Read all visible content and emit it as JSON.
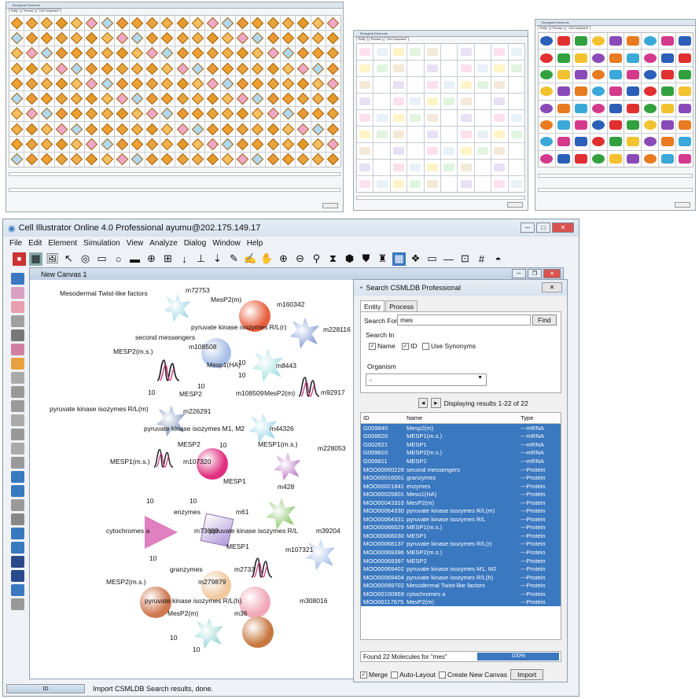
{
  "palette_windows": [
    {
      "title": "Biological Elements",
      "tabs": [
        "Entity",
        "Process",
        "Cell Component"
      ]
    },
    {
      "title": "Biological Elements",
      "tabs": [
        "Entity",
        "Process",
        "Cell Component"
      ]
    },
    {
      "title": "Biological Elements",
      "tabs": [
        "Entity",
        "Process",
        "Cell Component"
      ]
    }
  ],
  "app": {
    "title": "Cell Illustrator Online 4.0 Professional ayumu@202.175.149.17",
    "menu": [
      "File",
      "Edit",
      "Element",
      "Simulation",
      "View",
      "Analyze",
      "Dialog",
      "Window",
      "Help"
    ]
  },
  "canvas": {
    "title": "New Canvas 1",
    "labels": [
      "Mesodermal Twist-like factors",
      "m72753",
      "MesP2(m)",
      "m160342",
      "pyruvate kinase isozymes R/L(r)",
      "m228116",
      "second messengers",
      "m108508",
      "MESP2(m.s.)",
      "Mesp1(HA)",
      "m8443",
      "10",
      "10",
      "10",
      "10",
      "MESP2",
      "m108509",
      "MesP2(m)",
      "m92917",
      "pyruvate kinase isozymes R/L(m)",
      "m226291",
      "pyruvate kinase isozymes M1, M2",
      "m44326",
      "10",
      "MESP2",
      "MESP1(m.s.)",
      "m228053",
      "MESP1(m.s.)",
      "m107320",
      "MESP1",
      "m428",
      "10",
      "10",
      "enzymes",
      "m61",
      "cytochromes a",
      "m73600",
      "pyruvate kinase isozymes R/L",
      "m39204",
      "MESP1",
      "m107321",
      "10",
      "granzymes",
      "m2733",
      "MESP2(m.s.)",
      "m279879",
      "pyruvate kinase isozymes R/L(h)",
      "m308016",
      "MesP2(m)",
      "m36",
      "10",
      "10"
    ]
  },
  "status": {
    "box": "ID",
    "text": "Import CSMLDB Search results, done."
  },
  "search": {
    "title": "Search CSMLDB Professional",
    "tabs": [
      "Entity",
      "Process"
    ],
    "search_for_label": "Search For",
    "search_for_value": "mes",
    "find_label": "Find",
    "search_in_label": "Search In",
    "options": [
      "Name",
      "ID",
      "Use Synonyms"
    ],
    "organism_label": "Organism",
    "organism_value": "-",
    "displaying": "Displaying results 1-22 of 22",
    "columns": [
      "ID",
      "Name",
      "Type"
    ],
    "rows": [
      [
        "G009840",
        "Mesp2(m)",
        "---mRNA"
      ],
      [
        "G008620",
        "MESP1(m.s.)",
        "---mRNA"
      ],
      [
        "G002621",
        "MESP1",
        "---mRNA"
      ],
      [
        "G009810",
        "MESP2(m.s.)",
        "---mRNA"
      ],
      [
        "G009811",
        "MESP2",
        "---mRNA"
      ],
      [
        "MOO00000226",
        "second messengers",
        "---Protein"
      ],
      [
        "MOO00016001",
        "granzymes",
        "---Protein"
      ],
      [
        "MOO00021841",
        "enzymes",
        "---Protein"
      ],
      [
        "MOO00025801",
        "Meso1(HA)",
        "---Protein"
      ],
      [
        "MOO00043316",
        "MesP2(m)",
        "---Protein"
      ],
      [
        "MOO00064330",
        "pyruvate kinase isozymes R/L(m)",
        "---Protein"
      ],
      [
        "MOO00064331",
        "pyruvate kinase isozymes R/L",
        "---Protein"
      ],
      [
        "MOO00066029",
        "MESP1(m.s.)",
        "---Protein"
      ],
      [
        "MOO00066030",
        "MESP1",
        "---Protein"
      ],
      [
        "MOO00068137",
        "pyruvate kinase isozymes R/L(r)",
        "---Protein"
      ],
      [
        "MOO00069396",
        "MESP2(m.s.)",
        "---Protein"
      ],
      [
        "MOO00069397",
        "MESP2",
        "---Protein"
      ],
      [
        "MOO00069402",
        "pyruvate kinase isozymes M1, M2",
        "---Protein"
      ],
      [
        "MOO00069404",
        "pyruvate kinase isozymes R/L(h)",
        "---Protein"
      ],
      [
        "MOO00099702",
        "Mesodermal Twist-like factors",
        "---Protein"
      ],
      [
        "MOO00100959",
        "cytochromes a",
        "---Protein"
      ],
      [
        "MOO00117675",
        "MesP2(m)",
        "---Protein"
      ]
    ],
    "found": "Found 22 Molecules for \"mes\"",
    "progress": "100%",
    "progress_value": 1.0,
    "bottom": {
      "merge": "Merge",
      "auto_layout": "Auto-Layout",
      "new_canvas": "Create New Canvas",
      "import": "Import"
    }
  },
  "colors": {
    "selection": "#3a78c0",
    "accent": "#e39a2d"
  }
}
